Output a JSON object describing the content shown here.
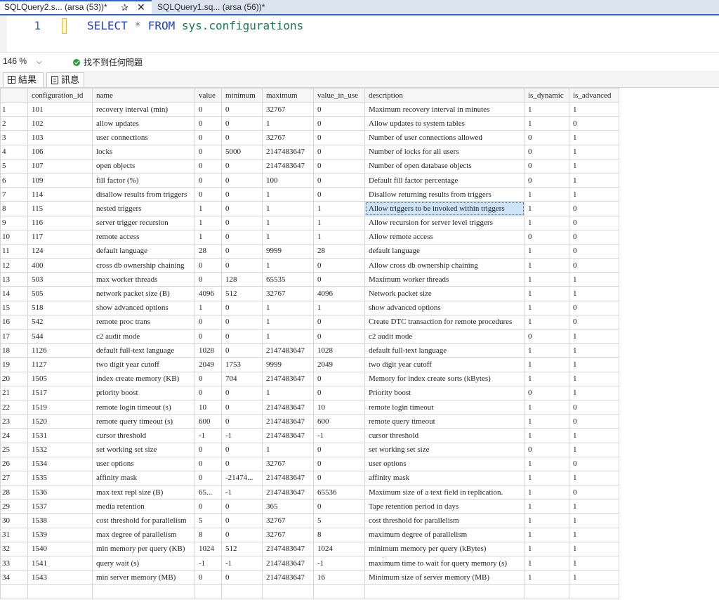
{
  "tabs": [
    {
      "label": "SQLQuery2.s... (arsa (53))*",
      "active": true
    },
    {
      "label": "SQLQuery1.sq... (arsa (56))*",
      "active": false
    }
  ],
  "editor": {
    "line_number": "1",
    "query": {
      "kw1": "SELECT",
      "op": " * ",
      "kw2": "FROM",
      "obj": " sys.configurations"
    }
  },
  "status": {
    "zoom": "146 %",
    "issues": "找不到任何問題"
  },
  "result_tabs": [
    {
      "label": "結果",
      "icon": "grid-icon"
    },
    {
      "label": "訊息",
      "icon": "messages-icon"
    }
  ],
  "grid": {
    "columns": [
      "",
      "configuration_id",
      "name",
      "value",
      "minimum",
      "maximum",
      "value_in_use",
      "description",
      "is_dynamic",
      "is_advanced"
    ],
    "selected": {
      "row": 7,
      "col": 7
    },
    "rows": [
      [
        "1",
        "101",
        "recovery interval (min)",
        "0",
        "0",
        "32767",
        "0",
        "Maximum recovery interval in minutes",
        "1",
        "1"
      ],
      [
        "2",
        "102",
        "allow updates",
        "0",
        "0",
        "1",
        "0",
        "Allow updates to system tables",
        "1",
        "0"
      ],
      [
        "3",
        "103",
        "user connections",
        "0",
        "0",
        "32767",
        "0",
        "Number of user connections allowed",
        "0",
        "1"
      ],
      [
        "4",
        "106",
        "locks",
        "0",
        "5000",
        "2147483647",
        "0",
        "Number of locks for all users",
        "0",
        "1"
      ],
      [
        "5",
        "107",
        "open objects",
        "0",
        "0",
        "2147483647",
        "0",
        "Number of open database objects",
        "0",
        "1"
      ],
      [
        "6",
        "109",
        "fill factor (%)",
        "0",
        "0",
        "100",
        "0",
        "Default fill factor percentage",
        "0",
        "1"
      ],
      [
        "7",
        "114",
        "disallow results from triggers",
        "0",
        "0",
        "1",
        "0",
        "Disallow returning results from triggers",
        "1",
        "1"
      ],
      [
        "8",
        "115",
        "nested triggers",
        "1",
        "0",
        "1",
        "1",
        "Allow triggers to be invoked within triggers",
        "1",
        "0"
      ],
      [
        "9",
        "116",
        "server trigger recursion",
        "1",
        "0",
        "1",
        "1",
        "Allow recursion for server level triggers",
        "1",
        "0"
      ],
      [
        "10",
        "117",
        "remote access",
        "1",
        "0",
        "1",
        "1",
        "Allow remote access",
        "0",
        "0"
      ],
      [
        "11",
        "124",
        "default language",
        "28",
        "0",
        "9999",
        "28",
        "default language",
        "1",
        "0"
      ],
      [
        "12",
        "400",
        "cross db ownership chaining",
        "0",
        "0",
        "1",
        "0",
        "Allow cross db ownership chaining",
        "1",
        "0"
      ],
      [
        "13",
        "503",
        "max worker threads",
        "0",
        "128",
        "65535",
        "0",
        "Maximum worker threads",
        "1",
        "1"
      ],
      [
        "14",
        "505",
        "network packet size (B)",
        "4096",
        "512",
        "32767",
        "4096",
        "Network packet size",
        "1",
        "1"
      ],
      [
        "15",
        "518",
        "show advanced options",
        "1",
        "0",
        "1",
        "1",
        "show advanced options",
        "1",
        "0"
      ],
      [
        "16",
        "542",
        "remote proc trans",
        "0",
        "0",
        "1",
        "0",
        "Create DTC transaction for remote procedures",
        "1",
        "0"
      ],
      [
        "17",
        "544",
        "c2 audit mode",
        "0",
        "0",
        "1",
        "0",
        "c2 audit mode",
        "0",
        "1"
      ],
      [
        "18",
        "1126",
        "default full-text language",
        "1028",
        "0",
        "2147483647",
        "1028",
        "default full-text language",
        "1",
        "1"
      ],
      [
        "19",
        "1127",
        "two digit year cutoff",
        "2049",
        "1753",
        "9999",
        "2049",
        "two digit year cutoff",
        "1",
        "1"
      ],
      [
        "20",
        "1505",
        "index create memory (KB)",
        "0",
        "704",
        "2147483647",
        "0",
        "Memory for index create sorts (kBytes)",
        "1",
        "1"
      ],
      [
        "21",
        "1517",
        "priority boost",
        "0",
        "0",
        "1",
        "0",
        "Priority boost",
        "0",
        "1"
      ],
      [
        "22",
        "1519",
        "remote login timeout (s)",
        "10",
        "0",
        "2147483647",
        "10",
        "remote login timeout",
        "1",
        "0"
      ],
      [
        "23",
        "1520",
        "remote query timeout (s)",
        "600",
        "0",
        "2147483647",
        "600",
        "remote query timeout",
        "1",
        "0"
      ],
      [
        "24",
        "1531",
        "cursor threshold",
        "-1",
        "-1",
        "2147483647",
        "-1",
        "cursor threshold",
        "1",
        "1"
      ],
      [
        "25",
        "1532",
        "set working set size",
        "0",
        "0",
        "1",
        "0",
        "set working set size",
        "0",
        "1"
      ],
      [
        "26",
        "1534",
        "user options",
        "0",
        "0",
        "32767",
        "0",
        "user options",
        "1",
        "0"
      ],
      [
        "27",
        "1535",
        "affinity mask",
        "0",
        "-21474...",
        "2147483647",
        "0",
        "affinity mask",
        "1",
        "1"
      ],
      [
        "28",
        "1536",
        "max text repl size (B)",
        "65...",
        "-1",
        "2147483647",
        "65536",
        "Maximum size of a text field in replication.",
        "1",
        "0"
      ],
      [
        "29",
        "1537",
        "media retention",
        "0",
        "0",
        "365",
        "0",
        "Tape retention period in days",
        "1",
        "1"
      ],
      [
        "30",
        "1538",
        "cost threshold for parallelism",
        "5",
        "0",
        "32767",
        "5",
        "cost threshold for parallelism",
        "1",
        "1"
      ],
      [
        "31",
        "1539",
        "max degree of parallelism",
        "8",
        "0",
        "32767",
        "8",
        "maximum degree of parallelism",
        "1",
        "1"
      ],
      [
        "32",
        "1540",
        "min memory per query (KB)",
        "1024",
        "512",
        "2147483647",
        "1024",
        "minimum memory per query (kBytes)",
        "1",
        "1"
      ],
      [
        "33",
        "1541",
        "query wait (s)",
        "-1",
        "-1",
        "2147483647",
        "-1",
        "maximum time to wait for query memory (s)",
        "1",
        "1"
      ],
      [
        "34",
        "1543",
        "min server memory (MB)",
        "0",
        "0",
        "2147483647",
        "16",
        "Minimum size of server memory (MB)",
        "1",
        "1"
      ],
      [
        "",
        "",
        "",
        "",
        "",
        "",
        "",
        "",
        "",
        ""
      ]
    ]
  }
}
